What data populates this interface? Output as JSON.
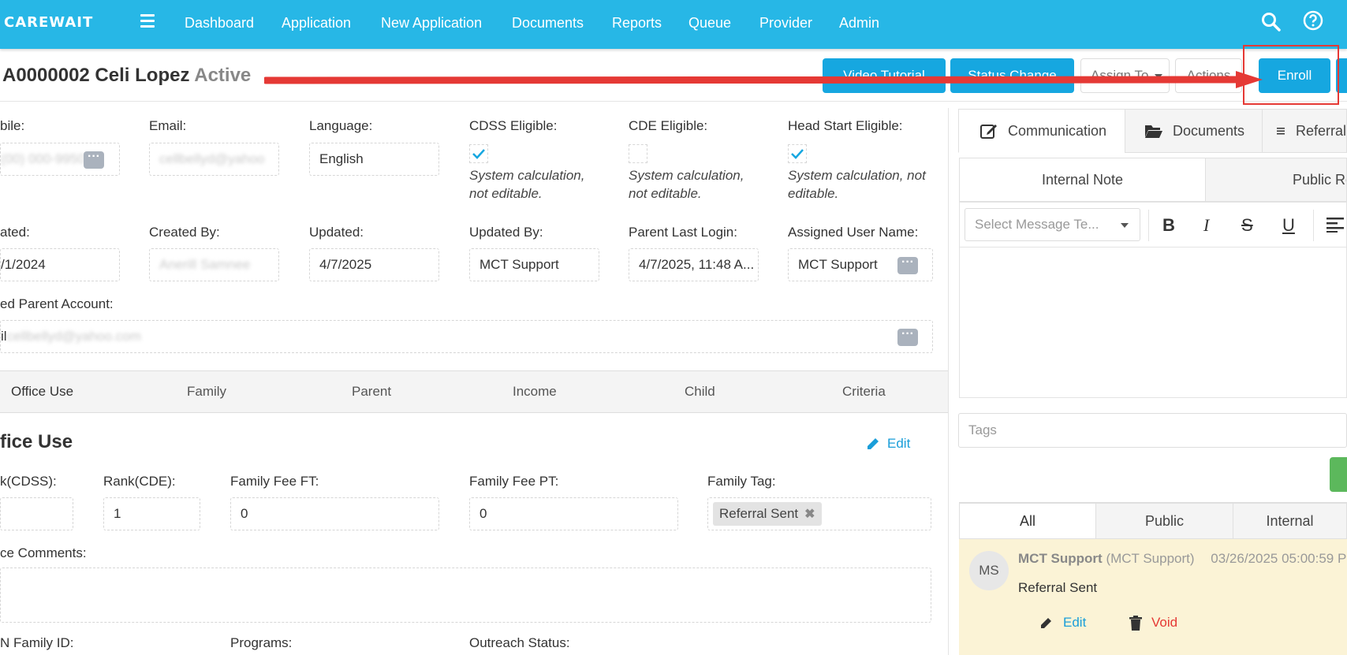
{
  "nav": {
    "logo": "CAREWAIT",
    "links": [
      "Dashboard",
      "Application",
      "New Application",
      "Documents",
      "Reports",
      "Queue",
      "Provider",
      "Admin"
    ]
  },
  "header": {
    "app_id": "A0000002 Celi Lopez",
    "status": "Active",
    "buttons": {
      "video_tutorial": "Video Tutorial",
      "status_change": "Status Change",
      "assign_to": "Assign To",
      "actions": "Actions",
      "enroll": "Enroll"
    }
  },
  "form": {
    "row1": {
      "mobile_label": "bile:",
      "mobile_value": "(00) 000-9950",
      "email_label": "Email:",
      "email_value": "cellbellyd@yahoo",
      "language_label": "Language:",
      "language_value": "English",
      "cdss_label": "CDSS Eligible:",
      "cde_label": "CDE Eligible:",
      "headstart_label": "Head Start Eligible:",
      "note_line1": "System calculation,",
      "note_line2": "not editable.",
      "headstart_note_line1": "System calculation, not",
      "headstart_note_line2": "editable."
    },
    "row2": {
      "created_label": "ated:",
      "created_value": "/1/2024",
      "created_by_label": "Created By:",
      "created_by_value": "Anerill Samnee",
      "updated_label": "Updated:",
      "updated_value": "4/7/2025",
      "updated_by_label": "Updated By:",
      "updated_by_value": "MCT Support",
      "last_login_label": "Parent Last Login:",
      "last_login_value": "4/7/2025, 11:48 A...",
      "assigned_label": "Assigned User Name:",
      "assigned_value": "MCT Support"
    },
    "linked_label": "ed Parent Account:",
    "linked_prefix": "il",
    "linked_value": "cellbellyd@yahoo.com"
  },
  "tabs": [
    "Office Use",
    "Family",
    "Parent",
    "Income",
    "Child",
    "Criteria"
  ],
  "office_use": {
    "title": "fice Use",
    "edit": "Edit",
    "rank_cdss_label": "k(CDSS):",
    "rank_cde_label": "Rank(CDE):",
    "rank_cde_value": "1",
    "fee_ft_label": "Family Fee FT:",
    "fee_ft_value": "0",
    "fee_pt_label": "Family Fee PT:",
    "fee_pt_value": "0",
    "tag_label": "Family Tag:",
    "tag_value": "Referral Sent",
    "comments_label": "ce Comments:",
    "family_id_label": "N Family ID:",
    "programs_label": "Programs:",
    "outreach_label": "Outreach Status:"
  },
  "right": {
    "tabs": [
      "Communication",
      "Documents",
      "Referral"
    ],
    "subtabs": [
      "Internal Note",
      "Public Re"
    ],
    "select_placeholder": "Select Message Te...",
    "tags_placeholder": "Tags",
    "filter_tabs": [
      "All",
      "Public",
      "Internal"
    ],
    "message": {
      "initials": "MS",
      "author": "MCT Support",
      "author_role": "(MCT Support)",
      "timestamp": "03/26/2025 05:00:59 P",
      "body": "Referral Sent",
      "edit": "Edit",
      "void": "Void"
    }
  },
  "colors": {
    "nav": "#27b7e6",
    "button": "#16a7e0",
    "annotation": "#e53935"
  }
}
